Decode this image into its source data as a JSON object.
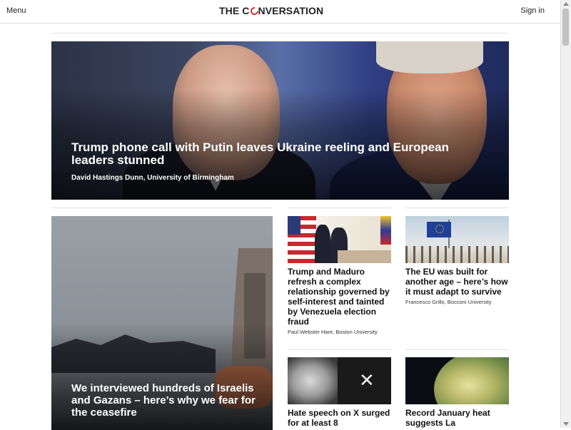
{
  "header": {
    "menu_label": "Menu",
    "logo_prefix": "THE C",
    "logo_suffix": "NVERSATION",
    "signin_label": "Sign in"
  },
  "hero": {
    "title": "Trump phone call with Putin leaves Ukraine reeling and European leaders stunned",
    "author": "David Hastings Dunn, University of Birmingham"
  },
  "feature": {
    "title": "We interviewed hundreds of Israelis and Gazans – here’s why we fear for the ceasefire"
  },
  "articles": [
    {
      "title": "Trump and Maduro refresh a complex relationship governed by self-interest and tainted by Venezuela election fraud",
      "author": "Paul Webster Hare, Boston University"
    },
    {
      "title": "The EU was built for another age – here’s how it must adapt to survive",
      "author": "Francesco Grillo, Bocconi University"
    },
    {
      "title": "Hate speech on X surged for at least 8",
      "author": ""
    },
    {
      "title": "Record January heat suggests La",
      "author": ""
    }
  ],
  "colors": {
    "logo_accent": "#d8352a",
    "hero_text": "#ffffff"
  }
}
